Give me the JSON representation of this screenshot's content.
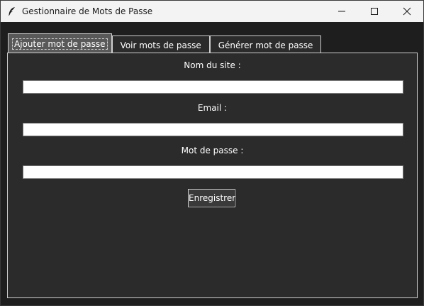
{
  "window": {
    "title": "Gestionnaire de Mots de Passe",
    "icon": "feather-icon",
    "controls": [
      "minimize-icon",
      "maximize-icon",
      "close-icon"
    ]
  },
  "tabs": [
    {
      "label": "Ajouter mot de passe",
      "active": true
    },
    {
      "label": "Voir mots de passe",
      "active": false
    },
    {
      "label": "Générer mot de passe",
      "active": false
    }
  ],
  "form": {
    "site_label": "Nom du site :",
    "site_value": "",
    "email_label": "Email :",
    "email_value": "",
    "password_label": "Mot de passe :",
    "password_value": "",
    "save_label": "Enregistrer"
  },
  "colors": {
    "background": "#1e1e1e",
    "panel": "#2b2b2b",
    "active_tab": "#595959",
    "text": "#ffffff",
    "titlebar": "#f3f3f3"
  }
}
